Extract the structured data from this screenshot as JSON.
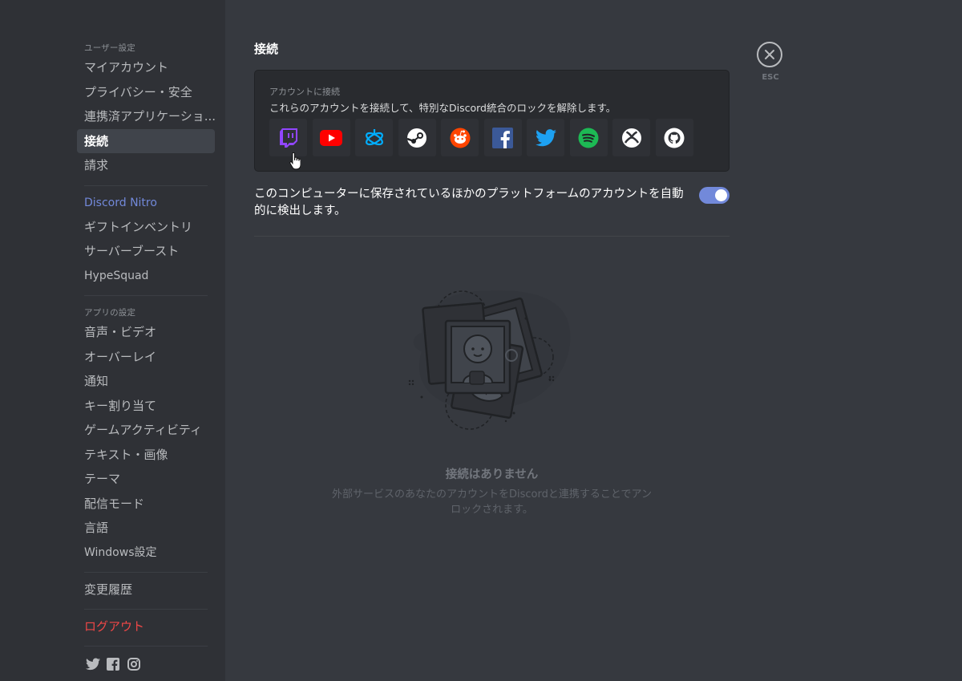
{
  "sidebar": {
    "user_settings_header": "ユーザー設定",
    "my_account": "マイアカウント",
    "privacy": "プライバシー・安全",
    "authorized_apps": "連携済アプリケーショ...",
    "connections": "接続",
    "billing": "請求",
    "nitro": "Discord Nitro",
    "gift_inventory": "ギフトインベントリ",
    "server_boost": "サーバーブースト",
    "hypesquad": "HypeSquad",
    "app_settings_header": "アプリの設定",
    "voice_video": "音声・ビデオ",
    "overlay": "オーバーレイ",
    "notifications": "通知",
    "keybinds": "キー割り当て",
    "game_activity": "ゲームアクティビティ",
    "text_images": "テキスト・画像",
    "theme": "テーマ",
    "streamer_mode": "配信モード",
    "language": "言語",
    "windows_settings": "Windows設定",
    "changelog": "変更履歴",
    "logout": "ログアウト",
    "social_icons": [
      "twitter-icon",
      "facebook-icon",
      "instagram-icon"
    ]
  },
  "main": {
    "title": "接続",
    "connect_label": "アカウントに接続",
    "connect_desc": "これらのアカウントを接続して、特別なDiscord統合のロックを解除します。",
    "services": [
      {
        "name": "twitch",
        "color": "#9146ff"
      },
      {
        "name": "youtube",
        "color": "#ff0000"
      },
      {
        "name": "battlenet",
        "color": "#00aeff"
      },
      {
        "name": "steam",
        "color": "#ffffff"
      },
      {
        "name": "reddit",
        "color": "#ff4500"
      },
      {
        "name": "facebook",
        "color": "#3b5998"
      },
      {
        "name": "twitter",
        "color": "#1da1f2"
      },
      {
        "name": "spotify",
        "color": "#1db954"
      },
      {
        "name": "xbox",
        "color": "#ffffff"
      },
      {
        "name": "github",
        "color": "#ffffff"
      }
    ],
    "detect_text": "このコンピューターに保存されているほかのプラットフォームのアカウントを自動的に検出します。",
    "detect_enabled": true,
    "empty_title": "接続はありません",
    "empty_desc": "外部サービスのあなたのアカウントをDiscordと連携することでアンロックされます。",
    "esc_label": "ESC"
  },
  "colors": {
    "accent": "#7289da",
    "danger": "#f04747",
    "sidebar_bg": "#2f3136",
    "main_bg": "#36393f"
  }
}
